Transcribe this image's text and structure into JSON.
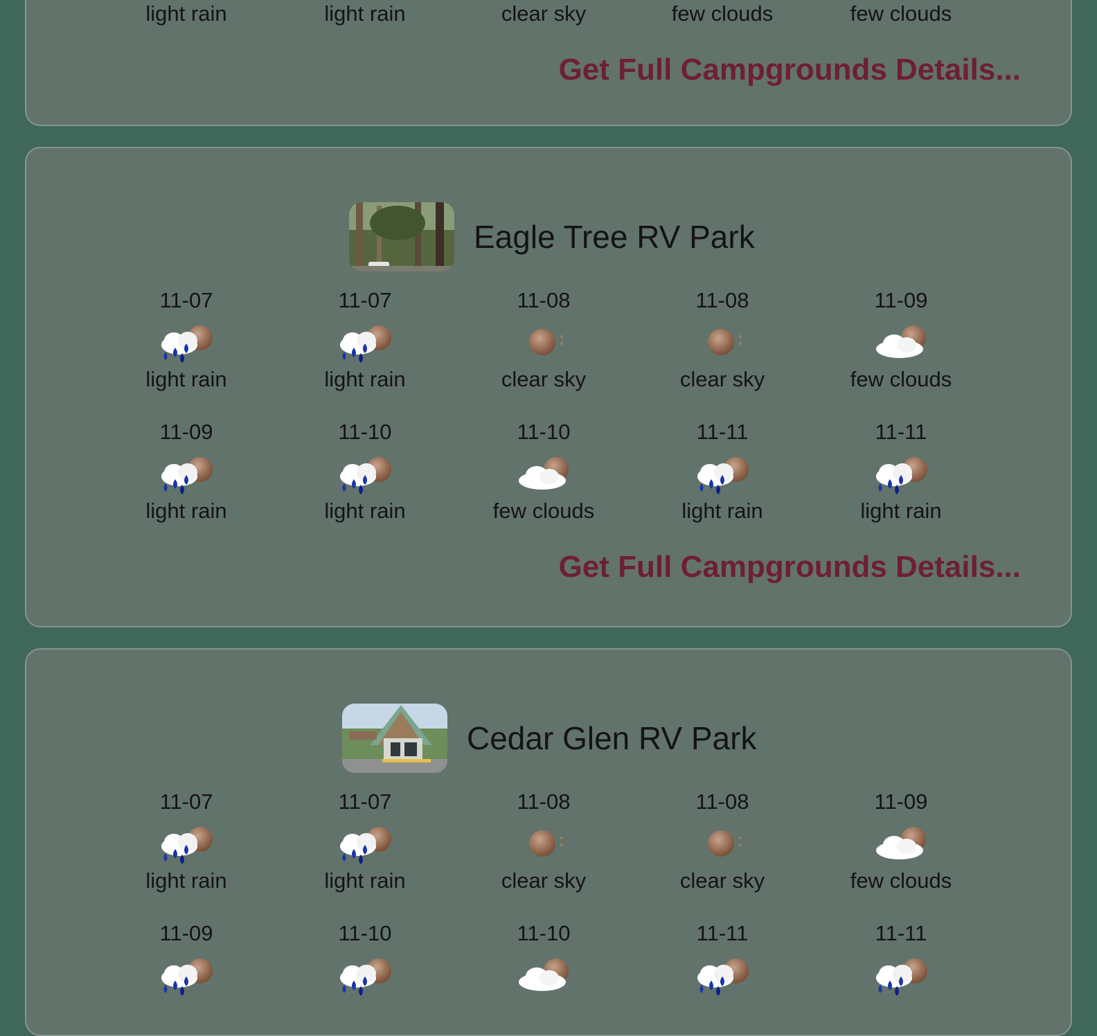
{
  "link_label": "Get Full Campgrounds Details...",
  "previous_card": {
    "descriptions": [
      "light rain",
      "light rain",
      "clear sky",
      "few clouds",
      "few clouds"
    ]
  },
  "campgrounds": [
    {
      "name": "Eagle Tree RV Park",
      "forecast": [
        {
          "date": "11-07",
          "icon": "light-rain-icon",
          "desc": "light rain"
        },
        {
          "date": "11-07",
          "icon": "light-rain-icon",
          "desc": "light rain"
        },
        {
          "date": "11-08",
          "icon": "clear-sky-icon",
          "desc": "clear sky"
        },
        {
          "date": "11-08",
          "icon": "clear-sky-icon",
          "desc": "clear sky"
        },
        {
          "date": "11-09",
          "icon": "few-clouds-icon",
          "desc": "few clouds"
        },
        {
          "date": "11-09",
          "icon": "light-rain-icon",
          "desc": "light rain"
        },
        {
          "date": "11-10",
          "icon": "light-rain-icon",
          "desc": "light rain"
        },
        {
          "date": "11-10",
          "icon": "few-clouds-icon",
          "desc": "few clouds"
        },
        {
          "date": "11-11",
          "icon": "light-rain-icon",
          "desc": "light rain"
        },
        {
          "date": "11-11",
          "icon": "light-rain-icon",
          "desc": "light rain"
        }
      ]
    },
    {
      "name": "Cedar Glen RV Park",
      "forecast": [
        {
          "date": "11-07",
          "icon": "light-rain-icon",
          "desc": "light rain"
        },
        {
          "date": "11-07",
          "icon": "light-rain-icon",
          "desc": "light rain"
        },
        {
          "date": "11-08",
          "icon": "clear-sky-icon",
          "desc": "clear sky"
        },
        {
          "date": "11-08",
          "icon": "clear-sky-icon",
          "desc": "clear sky"
        },
        {
          "date": "11-09",
          "icon": "few-clouds-icon",
          "desc": "few clouds"
        },
        {
          "date": "11-09",
          "icon": "light-rain-icon",
          "desc": ""
        },
        {
          "date": "11-10",
          "icon": "light-rain-icon",
          "desc": ""
        },
        {
          "date": "11-10",
          "icon": "few-clouds-icon",
          "desc": ""
        },
        {
          "date": "11-11",
          "icon": "light-rain-icon",
          "desc": ""
        },
        {
          "date": "11-11",
          "icon": "light-rain-icon",
          "desc": ""
        }
      ]
    }
  ]
}
